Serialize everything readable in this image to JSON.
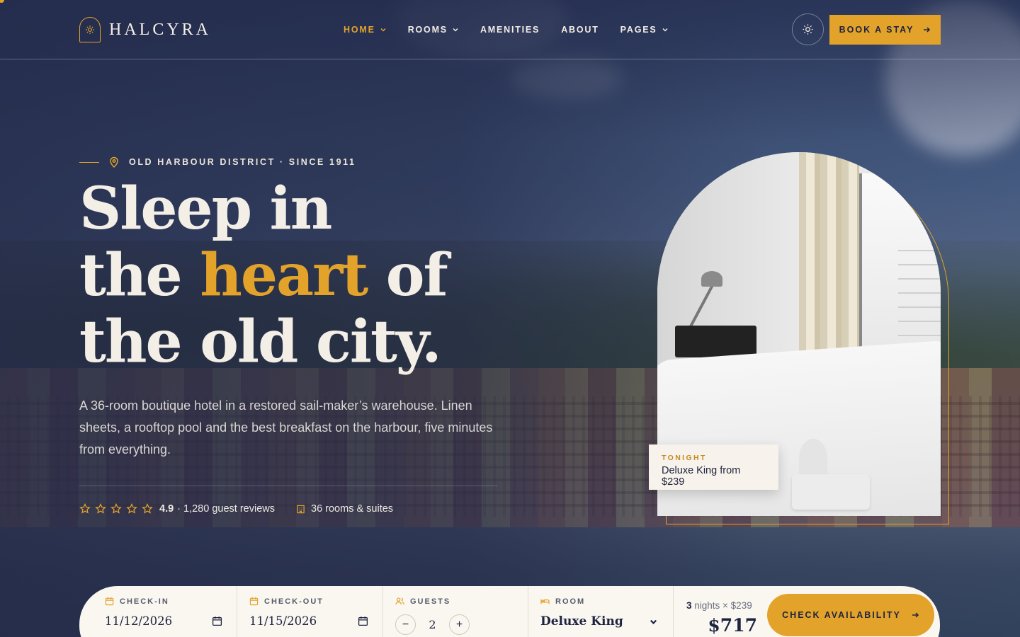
{
  "brand": {
    "name": "HALCYRA",
    "accent_color": "#e3a32a",
    "navy_color": "#1e2340"
  },
  "nav": {
    "items": [
      {
        "label": "HOME",
        "dropdown": true,
        "active": true
      },
      {
        "label": "ROOMS",
        "dropdown": true,
        "active": false
      },
      {
        "label": "AMENITIES",
        "dropdown": false,
        "active": false
      },
      {
        "label": "ABOUT",
        "dropdown": false,
        "active": false
      },
      {
        "label": "PAGES",
        "dropdown": true,
        "active": false
      }
    ],
    "theme_icon": "sun-icon",
    "book_label": "BOOK A STAY"
  },
  "hero": {
    "eyebrow": "OLD HARBOUR DISTRICT · SINCE 1911",
    "headline_line1": "Sleep in",
    "headline_line2_pre": "the ",
    "headline_line2_accent": "heart",
    "headline_line2_post": " of",
    "headline_line3": "the old city.",
    "lede": "A 36-room boutique hotel in a restored sail-maker’s warehouse. Linen sheets, a rooftop pool and the best breakfast on the harbour, five minutes from everything.",
    "rating": "4.9",
    "stars_count": 5,
    "reviews": "· 1,280 guest reviews",
    "rooms_stat": "36 rooms & suites"
  },
  "feature_card": {
    "label": "TONIGHT",
    "value": "Deluxe King from $239"
  },
  "booking": {
    "checkin_label": "CHECK-IN",
    "checkin_value": "11/12/2026",
    "checkout_label": "CHECK-OUT",
    "checkout_value": "11/15/2026",
    "guests_label": "GUESTS",
    "guests_value": "2",
    "room_label": "ROOM",
    "room_value": "Deluxe King",
    "nights": "3",
    "nights_text": " nights × $239",
    "total": "$717",
    "cta": "CHECK AVAILABILITY"
  }
}
